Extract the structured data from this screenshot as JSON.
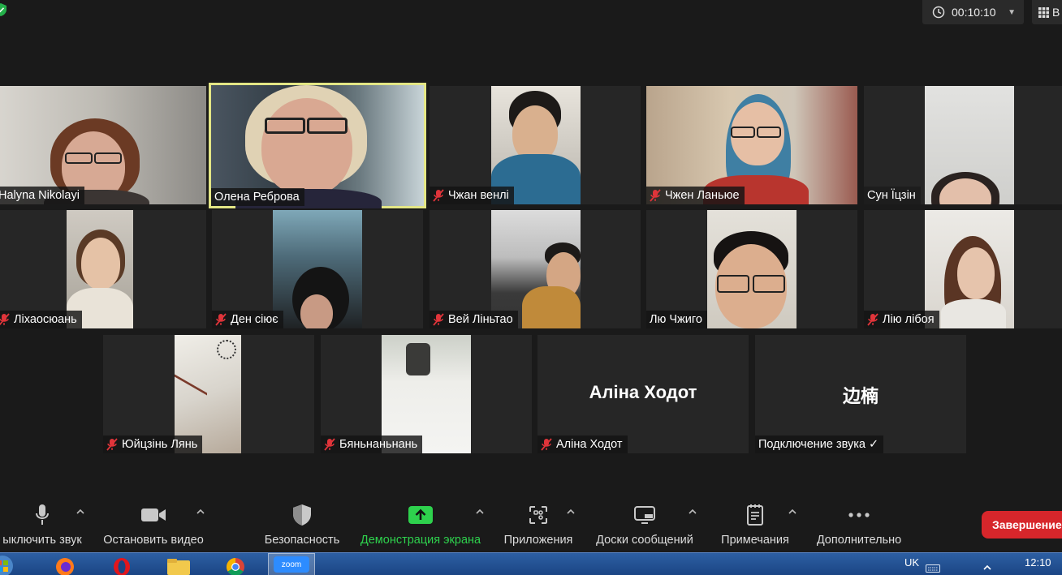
{
  "timer": {
    "value": "00:10:10"
  },
  "view": {
    "label": "В"
  },
  "participants": [
    {
      "name": "Halyna Nikolayi",
      "muted": false
    },
    {
      "name": "Олена Реброва",
      "muted": false
    },
    {
      "name": "Чжан венлі",
      "muted": true
    },
    {
      "name": "Чжен Ланьюе",
      "muted": true
    },
    {
      "name": "Сун Їцзін",
      "muted": false
    },
    {
      "name": "Ліхаосюань",
      "muted": true
    },
    {
      "name": "Ден сіює",
      "muted": true
    },
    {
      "name": "Вей Ліньтао",
      "muted": true
    },
    {
      "name": "Лю Чжиго",
      "muted": false
    },
    {
      "name": "Лію  лібоя",
      "muted": true
    },
    {
      "name": "Юйцзінь Лянь",
      "muted": true
    },
    {
      "name": "Бяньнаньнань",
      "muted": true
    },
    {
      "name": "Аліна Ходот",
      "muted": true,
      "avatar_text": "Аліна Ходот"
    },
    {
      "name": "Подключение звука ✓",
      "muted": false,
      "avatar_text": "边楠"
    }
  ],
  "toolbar": {
    "mute": "ыключить звук",
    "video": "Остановить видео",
    "security": "Безопасность",
    "share": "Демонстрация экрана",
    "apps": "Приложения",
    "whiteboards": "Доски сообщений",
    "notes": "Примечания",
    "more": "Дополнительно",
    "end": "Завершение"
  },
  "taskbar": {
    "zoom_label": "zoom",
    "language": "UK",
    "clock": "12:10"
  },
  "colors": {
    "active_speaker": "#e3e685",
    "share_green": "#2ed14d",
    "end_red": "#d7262b"
  }
}
